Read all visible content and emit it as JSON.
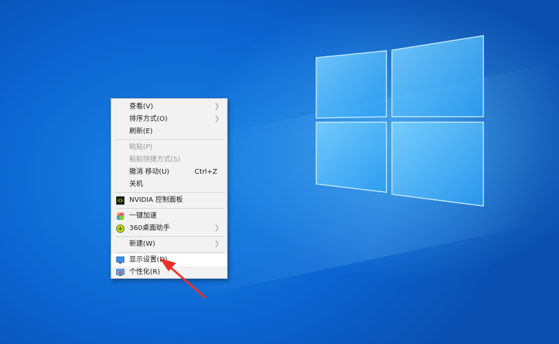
{
  "menu": {
    "items": [
      {
        "label": "查看(V)",
        "submenu": true,
        "icon": null
      },
      {
        "label": "排序方式(O)",
        "submenu": true,
        "icon": null
      },
      {
        "label": "刷新(E)",
        "submenu": false,
        "icon": null
      },
      {
        "label": "粘贴(P)",
        "disabled": true
      },
      {
        "label": "粘贴快捷方式(S)",
        "disabled": true
      },
      {
        "label": "撤消 移动(U)",
        "shortcut": "Ctrl+Z"
      },
      {
        "label": "关机"
      },
      {
        "label": "NVIDIA 控制面板",
        "icon": "nvidia-icon"
      },
      {
        "label": "一键加速",
        "icon": "speedup-icon"
      },
      {
        "label": "360桌面助手",
        "icon": "desktop-assistant-icon",
        "submenu": true
      },
      {
        "label": "新建(W)",
        "submenu": true
      },
      {
        "label": "显示设置(D)",
        "icon": "display-settings-icon",
        "highlighted": true
      },
      {
        "label": "个性化(R)",
        "icon": "personalize-icon"
      }
    ]
  },
  "colors": {
    "desktop": "#0a6fd6",
    "menu_bg": "#f2f2f2",
    "highlight": "#ffffff",
    "arrow": "#e8302a"
  }
}
